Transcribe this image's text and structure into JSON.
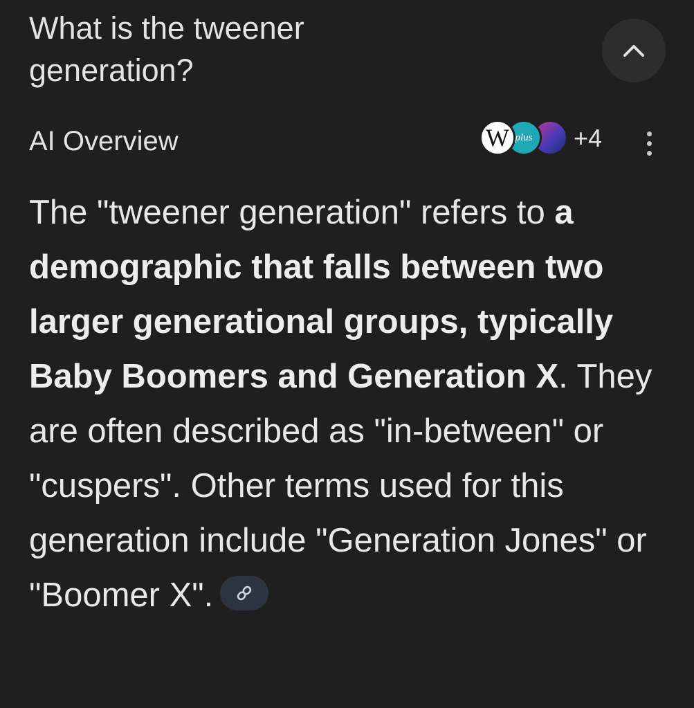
{
  "question": {
    "line1": "What is the tweener",
    "line2": "generation?"
  },
  "ai_overview": {
    "label": "AI Overview",
    "sources": [
      {
        "icon": "wikipedia-icon",
        "text": "W"
      },
      {
        "icon": "plus-source-icon",
        "text": "plus"
      },
      {
        "icon": "third-source-icon"
      }
    ],
    "more_sources": "+4"
  },
  "answer": {
    "p1": "The \"tweener generation\" refers to ",
    "b1": "a demographic that falls between two larger generational groups, typically Baby Boomers and Generation X",
    "p2": ". They are often described as \"in-between\" or \"cuspers\". Other terms used for this generation include \"Generation Jones\" or \"Boomer X\"."
  },
  "colors": {
    "background": "#1f1f1f",
    "text": "#e8e8e8",
    "chip": "#2c3440",
    "button": "#2d2d2d"
  }
}
